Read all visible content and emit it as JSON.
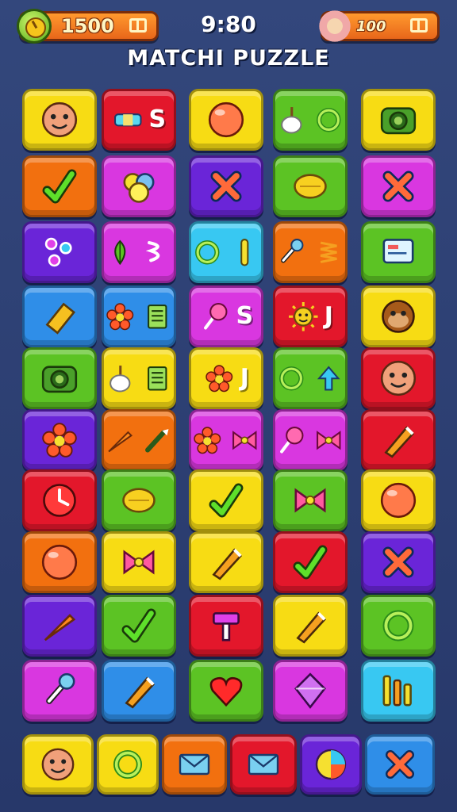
{
  "hud": {
    "score": "1500",
    "timer": "9:80",
    "lives": "100"
  },
  "title": "MATCHI PUZZLE",
  "colors": {
    "yellow": "#f7dc14",
    "red": "#e3172b",
    "green": "#5cc324",
    "orange": "#f2700f",
    "magenta": "#d937e0",
    "purple": "#6a25d8",
    "blue": "#2f8ee8",
    "cyan": "#38c8f2"
  },
  "board": {
    "rows": [
      [
        {
          "color": "yellow",
          "icons": [
            "cookie-face-icon"
          ]
        },
        {
          "color": "red",
          "icons": [
            "bandage-icon"
          ],
          "text": "S"
        },
        {
          "color": "yellow",
          "icons": [
            "ball-icon"
          ]
        },
        {
          "color": "green",
          "icons": [
            "marshmallow-icon",
            "ring-icon"
          ]
        },
        {
          "color": "yellow",
          "icons": [
            "camera-icon"
          ]
        }
      ],
      [
        {
          "color": "orange",
          "icons": [
            "check-icon"
          ]
        },
        {
          "color": "magenta",
          "icons": [
            "flower-cluster-icon"
          ]
        },
        {
          "color": "purple",
          "icons": [
            "cross-icon"
          ]
        },
        {
          "color": "green",
          "icons": [
            "lemon-icon"
          ]
        },
        {
          "color": "magenta",
          "icons": [
            "cross-icon"
          ]
        }
      ],
      [
        {
          "color": "purple",
          "icons": [
            "dots-icon"
          ]
        },
        {
          "color": "magenta",
          "icons": [
            "leaf-icon",
            "squiggle-icon"
          ]
        },
        {
          "color": "cyan",
          "icons": [
            "ring-icon",
            "bar-icon"
          ]
        },
        {
          "color": "orange",
          "icons": [
            "pin-icon",
            "spring-icon"
          ]
        },
        {
          "color": "green",
          "icons": [
            "card-icon"
          ]
        }
      ],
      [
        {
          "color": "blue",
          "icons": [
            "eraser-icon"
          ]
        },
        {
          "color": "blue",
          "icons": [
            "flower-icon",
            "note-icon"
          ]
        },
        {
          "color": "magenta",
          "icons": [
            "lollipop-icon"
          ],
          "text": "S"
        },
        {
          "color": "red",
          "icons": [
            "sun-face-icon"
          ],
          "text": "J"
        },
        {
          "color": "yellow",
          "icons": [
            "monkey-icon"
          ]
        }
      ],
      [
        {
          "color": "green",
          "icons": [
            "camera-icon"
          ]
        },
        {
          "color": "yellow",
          "icons": [
            "marshmallow-icon",
            "note-icon"
          ]
        },
        {
          "color": "yellow",
          "icons": [
            "flower-icon"
          ],
          "text": "J"
        },
        {
          "color": "green",
          "icons": [
            "ring-icon",
            "arrow-up-icon"
          ]
        },
        {
          "color": "red",
          "icons": [
            "cookie-face-icon"
          ]
        }
      ],
      [
        {
          "color": "purple",
          "icons": [
            "flower-icon"
          ]
        },
        {
          "color": "orange",
          "icons": [
            "carrot-icon",
            "brush-icon"
          ]
        },
        {
          "color": "magenta",
          "icons": [
            "flower-icon",
            "bow-icon"
          ]
        },
        {
          "color": "magenta",
          "icons": [
            "lollipop-icon",
            "bow-icon"
          ]
        },
        {
          "color": "red",
          "icons": [
            "pen-icon"
          ]
        }
      ],
      [
        {
          "color": "red",
          "icons": [
            "clock-icon"
          ]
        },
        {
          "color": "green",
          "icons": [
            "lemon-icon"
          ]
        },
        {
          "color": "yellow",
          "icons": [
            "check-icon"
          ]
        },
        {
          "color": "green",
          "icons": [
            "bow-icon"
          ]
        },
        {
          "color": "yellow",
          "icons": [
            "ball-icon"
          ]
        }
      ],
      [
        {
          "color": "orange",
          "icons": [
            "ball-icon"
          ]
        },
        {
          "color": "yellow",
          "icons": [
            "bow-icon"
          ]
        },
        {
          "color": "yellow",
          "icons": [
            "pen-icon"
          ]
        },
        {
          "color": "red",
          "icons": [
            "check-icon"
          ]
        },
        {
          "color": "purple",
          "icons": [
            "cross-icon"
          ]
        }
      ],
      [
        {
          "color": "purple",
          "icons": [
            "carrot-icon"
          ]
        },
        {
          "color": "green",
          "icons": [
            "check-icon"
          ]
        },
        {
          "color": "red",
          "icons": [
            "hammer-icon"
          ]
        },
        {
          "color": "yellow",
          "icons": [
            "pen-icon"
          ]
        },
        {
          "color": "green",
          "icons": [
            "ring-icon"
          ]
        }
      ],
      [
        {
          "color": "magenta",
          "icons": [
            "pin-icon"
          ]
        },
        {
          "color": "blue",
          "icons": [
            "pen-icon"
          ]
        },
        {
          "color": "green",
          "icons": [
            "heart-icon"
          ]
        },
        {
          "color": "magenta",
          "icons": [
            "gem-icon"
          ]
        },
        {
          "color": "cyan",
          "icons": [
            "bars-icon"
          ]
        }
      ]
    ]
  },
  "tray": {
    "tiles": [
      {
        "color": "yellow",
        "icons": [
          "cookie-face-icon"
        ]
      },
      {
        "color": "yellow",
        "icons": [
          "ring-icon"
        ]
      },
      {
        "color": "orange",
        "icons": [
          "envelope-icon"
        ]
      },
      {
        "color": "red",
        "icons": [
          "envelope-icon"
        ]
      },
      {
        "color": "purple",
        "icons": [
          "pie-icon"
        ]
      },
      {
        "color": "blue",
        "icons": [
          "cross-icon"
        ]
      }
    ]
  }
}
